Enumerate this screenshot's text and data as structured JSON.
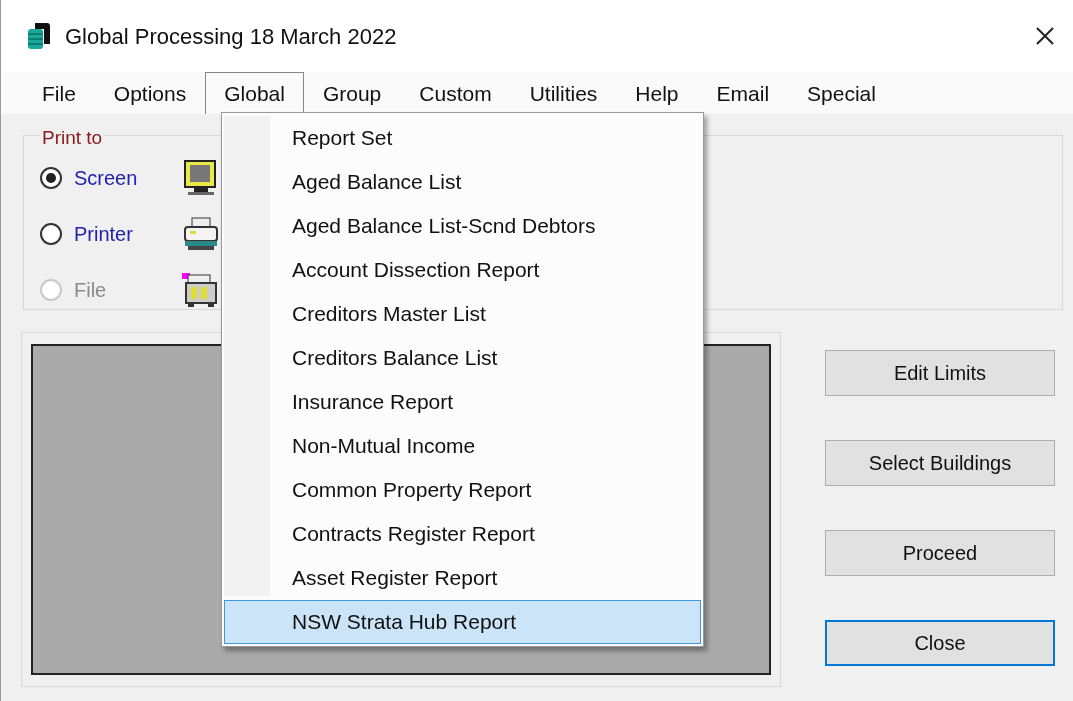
{
  "window": {
    "title": "Global Processing 18 March 2022"
  },
  "menu_bar": [
    {
      "label": "File",
      "selected": false
    },
    {
      "label": "Options",
      "selected": false
    },
    {
      "label": "Global",
      "selected": true
    },
    {
      "label": "Group",
      "selected": false
    },
    {
      "label": "Custom",
      "selected": false
    },
    {
      "label": "Utilities",
      "selected": false
    },
    {
      "label": "Help",
      "selected": false
    },
    {
      "label": "Email",
      "selected": false
    },
    {
      "label": "Special",
      "selected": false
    }
  ],
  "dropdown": {
    "items": [
      {
        "label": "Report Set",
        "selected": false
      },
      {
        "label": "Aged Balance List",
        "selected": false
      },
      {
        "label": "Aged Balance List-Scnd Debtors",
        "selected": false
      },
      {
        "label": "Account Dissection Report",
        "selected": false
      },
      {
        "label": "Creditors Master List",
        "selected": false
      },
      {
        "label": "Creditors Balance List",
        "selected": false
      },
      {
        "label": "Insurance Report",
        "selected": false
      },
      {
        "label": "Non-Mutual Income",
        "selected": false
      },
      {
        "label": "Common Property Report",
        "selected": false
      },
      {
        "label": "Contracts Register Report",
        "selected": false
      },
      {
        "label": "Asset Register Report",
        "selected": false
      },
      {
        "label": "NSW Strata Hub Report",
        "selected": true
      }
    ]
  },
  "print_to": {
    "label": "Print to",
    "options": [
      {
        "label": "Screen",
        "kind": "monitor",
        "selected": true,
        "disabled": false
      },
      {
        "label": "Printer",
        "kind": "printer",
        "selected": false,
        "disabled": false
      },
      {
        "label": "File",
        "kind": "cabinet",
        "selected": false,
        "disabled": true
      }
    ]
  },
  "buttons": [
    {
      "label": "Edit Limits",
      "focused": false
    },
    {
      "label": "Select Buildings",
      "focused": false
    },
    {
      "label": "Proceed",
      "focused": false
    },
    {
      "label": "Close",
      "focused": true
    }
  ]
}
